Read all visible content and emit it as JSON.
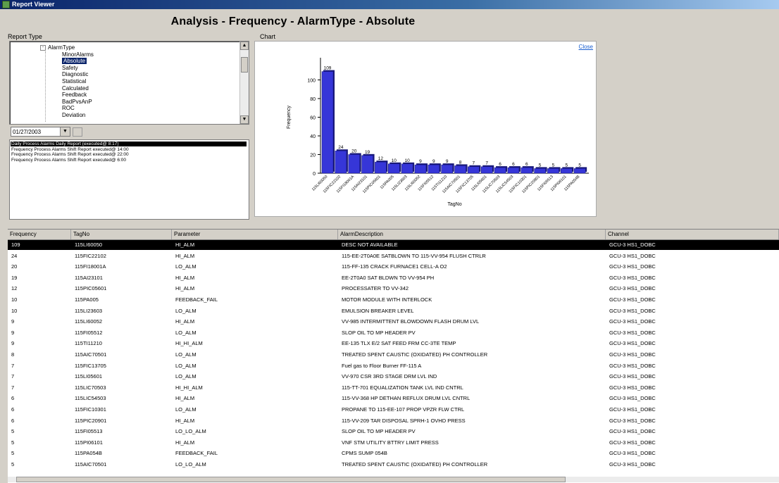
{
  "window": {
    "title": "Report Viewer"
  },
  "heading": "Analysis - Frequency - AlarmType - Absolute",
  "report_type_label": "Report Type",
  "chart_group_label": "Chart",
  "tree": {
    "items": [
      {
        "label": "AlarmType",
        "indent": 1,
        "selected": false
      },
      {
        "label": "MinorAlarms",
        "indent": 2,
        "selected": false
      },
      {
        "label": "Absolute",
        "indent": 2,
        "selected": true
      },
      {
        "label": "Safety",
        "indent": 2,
        "selected": false
      },
      {
        "label": "Diagnostic",
        "indent": 2,
        "selected": false
      },
      {
        "label": "Statistical",
        "indent": 2,
        "selected": false
      },
      {
        "label": "Calculated",
        "indent": 2,
        "selected": false
      },
      {
        "label": "Feedback",
        "indent": 2,
        "selected": false
      },
      {
        "label": "BadPvsAnP",
        "indent": 2,
        "selected": false
      },
      {
        "label": "ROC",
        "indent": 2,
        "selected": false
      },
      {
        "label": "Deviation",
        "indent": 2,
        "selected": false
      }
    ]
  },
  "date_combo": {
    "value": "01/27/2003"
  },
  "report_list": [
    "Daily Process Alarms Daily Report (executed@ 8:17)",
    "Frequency Process Alarms Shift Report executed@ 14:00",
    "Frequency Process Alarms Shift Report executed@ 22:00",
    "Frequency Process Alarms Shift Report executed@ 6:00"
  ],
  "close_label": "Close",
  "chart_data": {
    "type": "bar",
    "xlabel": "TagNo",
    "ylabel": "Frequency",
    "ylim": [
      0,
      120
    ],
    "yticks": [
      0,
      20,
      40,
      60,
      80,
      100
    ],
    "values": [
      109,
      24,
      20,
      19,
      12,
      10,
      10,
      9,
      9,
      9,
      8,
      7,
      7,
      6,
      6,
      6,
      5,
      5,
      5,
      5
    ],
    "categories": [
      "115LI60050",
      "115FIC22102",
      "115FI18001A",
      "115AI23101",
      "115PIC05601",
      "115PA005",
      "115LI23603",
      "115LI60052",
      "115FI05512",
      "115TI11210",
      "115AIC70501",
      "115FIC13705",
      "115LI05601",
      "115LIC70503",
      "115LIC54503",
      "115FIC10301",
      "115PIC20901",
      "115FI05513",
      "115PI06101",
      "115PA054B"
    ],
    "bar_color": "#3636d8",
    "label_color": "#000000"
  },
  "table": {
    "columns": [
      "Frequency",
      "TagNo",
      "Parameter",
      "AlarmDescription",
      "Channel"
    ],
    "rows": [
      [
        "109",
        "115LI60050",
        "HI_ALM",
        "DESC NOT AVAILABLE",
        "GCU-3 HS1_DOBC"
      ],
      [
        "24",
        "115FIC22102",
        "HI_ALM",
        "115-EE-2T0A0E SATBLOWN TO 115-VV-954 FLUSH CTRLR",
        "GCU-3 HS1_DOBC"
      ],
      [
        "20",
        "115FI18001A",
        "LO_ALM",
        "115-FF-135 CRACK FURNACE1 CELL-A O2",
        "GCU-3 HS1_DOBC"
      ],
      [
        "19",
        "115AI23101",
        "HI_ALM",
        "EE-2T0A0 SAT BLDWN TO VV-954 PH",
        "GCU-3 HS1_DOBC"
      ],
      [
        "12",
        "115PIC05601",
        "HI_ALM",
        "PROCESSATER TO VV-342",
        "GCU-3 HS1_DOBC"
      ],
      [
        "10",
        "115PA005",
        "FEEDBACK_FAIL",
        "MOTOR MODULE WITH INTERLOCK",
        "GCU-3 HS1_DOBC"
      ],
      [
        "10",
        "115LI23603",
        "LO_ALM",
        "EMULSION BREAKER LEVEL",
        "GCU-3 HS1_DOBC"
      ],
      [
        "9",
        "115LI60052",
        "HI_ALM",
        "VV-985 INTERMITTENT BLOWDOWN FLASH DRUM LVL",
        "GCU-3 HS1_DOBC"
      ],
      [
        "9",
        "115FI05512",
        "LO_ALM",
        "SLOP OIL TO MP HEADER PV",
        "GCU-3 HS1_DOBC"
      ],
      [
        "9",
        "115TI11210",
        "HI_HI_ALM",
        "EE-135 TLX E/2 SAT FEED FRM CC-3TE TEMP",
        "GCU-3 HS1_DOBC"
      ],
      [
        "8",
        "115AIC70501",
        "LO_ALM",
        "TREATED SPENT CAUSTIC (OXIDATED) PH CONTROLLER",
        "GCU-3 HS1_DOBC"
      ],
      [
        "7",
        "115FIC13705",
        "LO_ALM",
        "Fuel gas to Floor Burner FF-115 A",
        "GCU-3 HS1_DOBC"
      ],
      [
        "7",
        "115LI05601",
        "LO_ALM",
        "VV-970 CSR 3RD STAGE DRM LVL IND",
        "GCU-3 HS1_DOBC"
      ],
      [
        "7",
        "115LIC70503",
        "HI_HI_ALM",
        "115-TT-701 EQUALIZATION TANK LVL IND CNTRL",
        "GCU-3 HS1_DOBC"
      ],
      [
        "6",
        "115LIC54503",
        "HI_ALM",
        "115-VV-368 HP DETHAN REFLUX DRUM LVL CNTRL",
        "GCU-3 HS1_DOBC"
      ],
      [
        "6",
        "115FIC10301",
        "LO_ALM",
        "PROPANE TO 115-EE-107 PROP VPZR FLW CTRL",
        "GCU-3 HS1_DOBC"
      ],
      [
        "6",
        "115PIC20901",
        "HI_ALM",
        "115-VV-209 TAR DISPOSAL SPRH-1 OVHD PRESS",
        "GCU-3 HS1_DOBC"
      ],
      [
        "5",
        "115FI05513",
        "LO_LO_ALM",
        "SLOP OIL TO MP HEADER PV",
        "GCU-3 HS1_DOBC"
      ],
      [
        "5",
        "115PI06101",
        "HI_ALM",
        "VNF STM UTILITY BTTRY LIMIT PRESS",
        "GCU-3 HS1_DOBC"
      ],
      [
        "5",
        "115PA054B",
        "FEEDBACK_FAIL",
        "CPMS SUMP 054B",
        "GCU-3 HS1_DOBC"
      ],
      [
        "5",
        "115AIC70501",
        "LO_LO_ALM",
        "TREATED SPENT CAUSTIC (OXIDATED) PH CONTROLLER",
        "GCU-3 HS1_DOBC"
      ]
    ]
  }
}
